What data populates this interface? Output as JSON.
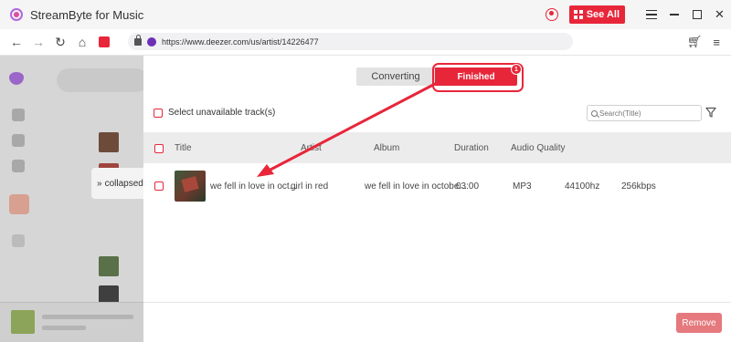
{
  "app": {
    "title": "StreamByte for Music",
    "see_all_label": "See All"
  },
  "browser": {
    "url": "https://www.deezer.com/us/artist/14226477"
  },
  "side_tab": {
    "label": "collapsed"
  },
  "panel": {
    "tabs": [
      {
        "label": "Converting"
      },
      {
        "label": "Finished"
      }
    ],
    "finished_badge": "1",
    "select_label": "Select unavailable track(s)",
    "search_placeholder": "Search(Title)",
    "columns": {
      "title": "Title",
      "artist": "Artist",
      "album": "Album",
      "duration": "Duration",
      "audio_quality": "Audio Quality"
    },
    "rows": [
      {
        "title": "we fell in love in oct...",
        "artist": "girl in red",
        "album": "we fell in love in octobe...",
        "duration": "03:00",
        "format": "MP3",
        "sample_rate": "44100hz",
        "bitrate": "256kbps"
      }
    ],
    "remove_label": "Remove"
  },
  "colors": {
    "accent": "#e8263a",
    "remove_button": "#e5797d"
  }
}
